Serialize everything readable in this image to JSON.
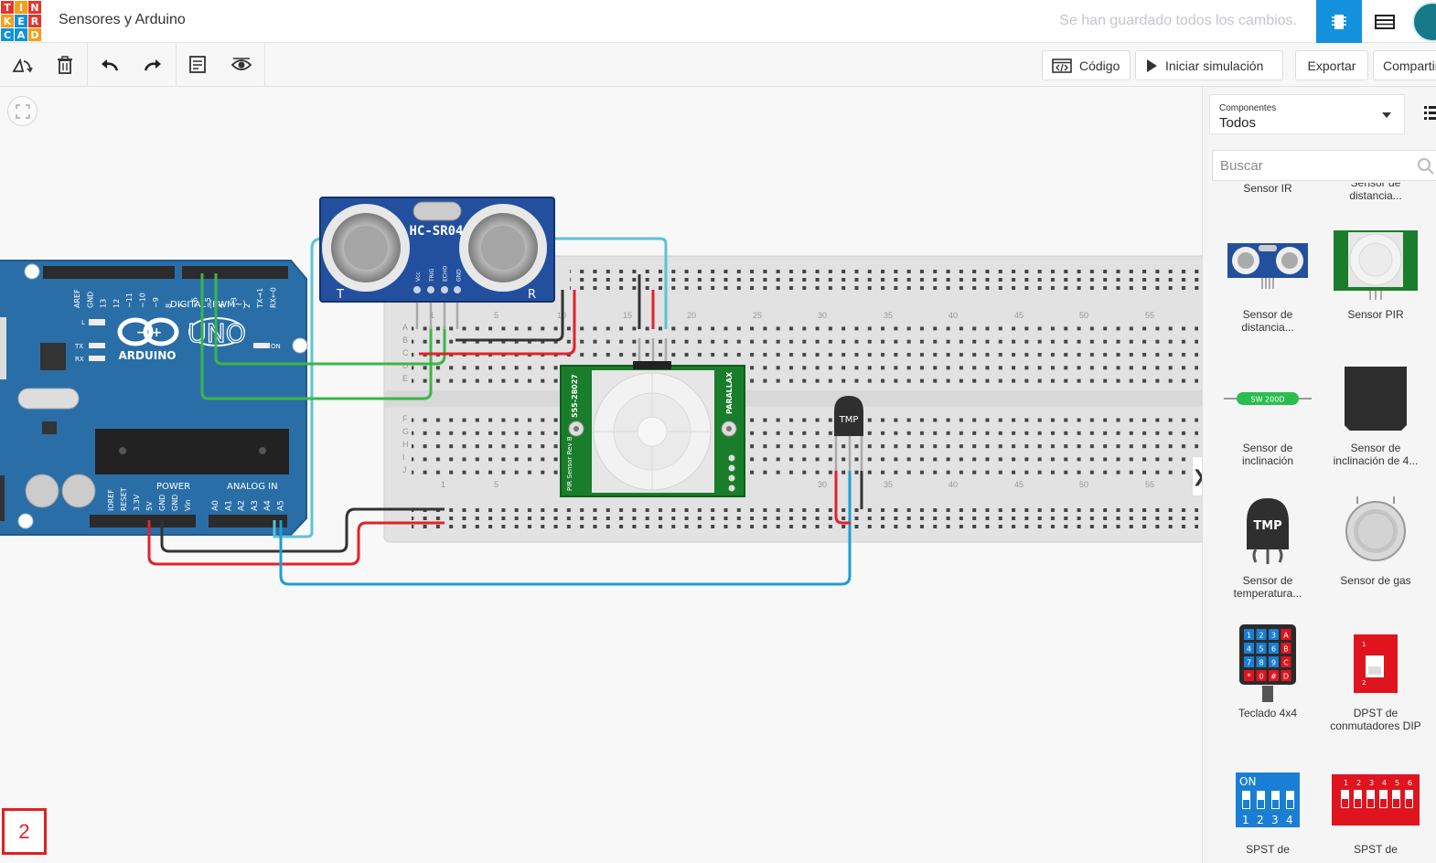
{
  "header": {
    "logo_letters": [
      "T",
      "I",
      "N",
      "K",
      "E",
      "R",
      "C",
      "A",
      "D"
    ],
    "logo_colors": [
      "#e7342b",
      "#f99d1c",
      "#e7342b",
      "#f99d1c",
      "#1391dc",
      "#e7342b",
      "#1391dc",
      "#1391dc",
      "#f99d1c"
    ],
    "title": "Sensores y Arduino",
    "save_status": "Se han guardado todos los cambios.",
    "views": [
      "circuit-view-icon",
      "schematic-view-icon"
    ],
    "accent_color": "#1391dc"
  },
  "toolbar": {
    "tools": [
      "rotate-icon",
      "delete-icon",
      "undo-icon",
      "redo-icon",
      "notes-icon",
      "visibility-icon"
    ],
    "code_label": "Código",
    "simulate_label": "Iniciar simulación",
    "export_label": "Exportar",
    "share_label": "Compartir"
  },
  "canvas": {
    "page_number": "2",
    "arduino": {
      "brand": "ARDUINO",
      "model": "UNO",
      "digital_label": "DIGITAL (PWM~)",
      "power_label": "POWER",
      "analog_label": "ANALOG IN",
      "on_label": "ON",
      "l_label": "L",
      "tx_label": "TX",
      "rx_label": "RX",
      "digital_pins": [
        "AREF",
        "GND",
        "13",
        "12",
        "~11",
        "~10",
        "~9",
        "8",
        "7",
        "~6",
        "~5",
        "4",
        "~3",
        "2",
        "TX→1",
        "RX←0"
      ],
      "power_pins": [
        "IOREF",
        "RESET",
        "3.3V",
        "5V",
        "GND",
        "GND",
        "Vin"
      ],
      "analog_pins": [
        "A0",
        "A1",
        "A2",
        "A3",
        "A4",
        "A5"
      ]
    },
    "ultrasonic": {
      "model": "HC-SR04",
      "pins": [
        "Vcc",
        "TRIG",
        "ECHO",
        "GND"
      ],
      "left_mark": "T",
      "right_mark": "R"
    },
    "pir": {
      "part": "555-28027",
      "brand": "PARALLAX",
      "caption": "PIR Sensor Rev B"
    },
    "tmp_label": "TMP",
    "breadboard": {
      "rows": [
        "A",
        "B",
        "C",
        "D",
        "E",
        "F",
        "G",
        "H",
        "I",
        "J"
      ],
      "columns": [
        "1",
        "5",
        "10",
        "15",
        "20",
        "25",
        "30",
        "35",
        "40",
        "45",
        "50",
        "55"
      ]
    },
    "wire_colors": {
      "red": "#e3212a",
      "black": "#333333",
      "green": "#3cb54a",
      "blue": "#1e9fd3",
      "cyan": "#5bc3d7"
    }
  },
  "panel": {
    "components_label": "Componentes",
    "components_value": "Todos",
    "search_placeholder": "Buscar",
    "items": [
      {
        "name": "Sensor IR",
        "icon": "ir-sensor-icon"
      },
      {
        "name": "Sensor de distancia...",
        "icon": "distance-sensor-icon"
      },
      {
        "name": "Sensor de distancia...",
        "icon": "ultrasonic-sensor-icon"
      },
      {
        "name": "Sensor PIR",
        "icon": "pir-sensor-icon"
      },
      {
        "name": "Sensor de inclinación",
        "icon": "tilt-sensor-icon",
        "thumb_label": "SW 200D"
      },
      {
        "name": "Sensor de inclinación de 4...",
        "icon": "tilt-4-sensor-icon"
      },
      {
        "name": "Sensor de temperatura...",
        "icon": "temperature-sensor-icon",
        "thumb_label": "TMP"
      },
      {
        "name": "Sensor de gas",
        "icon": "gas-sensor-icon"
      },
      {
        "name": "Teclado 4x4",
        "icon": "keypad-icon",
        "thumb_keys": [
          "1",
          "2",
          "3",
          "A",
          "4",
          "5",
          "6",
          "B",
          "7",
          "8",
          "9",
          "C",
          "*",
          "0",
          "#",
          "D"
        ]
      },
      {
        "name": "DPST de conmutadores DIP",
        "icon": "dpst-switch-icon"
      },
      {
        "name": "SPST de",
        "icon": "spst-4-switch-icon",
        "thumb_label": "ON",
        "thumb_numbers": [
          "1",
          "2",
          "3",
          "4"
        ]
      },
      {
        "name": "SPST de",
        "icon": "spst-8-switch-icon",
        "thumb_numbers": [
          "1",
          "2",
          "3",
          "4",
          "5",
          "6"
        ]
      }
    ]
  }
}
